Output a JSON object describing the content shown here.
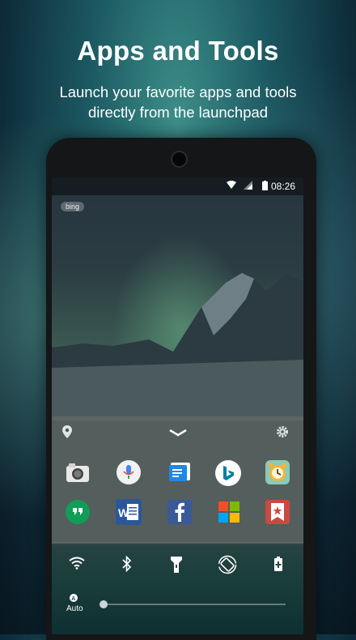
{
  "promo": {
    "title": "Apps and Tools",
    "subtitle_line1": "Launch your favorite apps and tools",
    "subtitle_line2": "directly from the launchpad"
  },
  "statusbar": {
    "time": "08:26",
    "icons": [
      "wifi-icon",
      "signal-icon",
      "battery-icon"
    ]
  },
  "wallpaper": {
    "badge": "bing"
  },
  "launchpad": {
    "top_icons": [
      "location-pin-icon",
      "chevron-down-icon",
      "gear-icon"
    ],
    "apps_row1": [
      "camera-app-icon",
      "voice-search-app-icon",
      "messages-app-icon",
      "bing-app-icon",
      "alarm-clock-app-icon"
    ],
    "apps_row2": [
      "hangouts-app-icon",
      "word-app-icon",
      "facebook-app-icon",
      "microsoft-store-app-icon",
      "wunderlist-app-icon"
    ],
    "toggles": [
      "wifi-toggle-icon",
      "bluetooth-toggle-icon",
      "flashlight-toggle-icon",
      "rotation-toggle-icon",
      "battery-saver-toggle-icon"
    ],
    "brightness": {
      "auto_label": "Auto",
      "level": 0.02
    }
  },
  "colors": {
    "accent_bing": "#00809d",
    "facebook": "#3b5998",
    "word": "#2b579a",
    "hangouts": "#0f9d58",
    "wunderlist": "#c94a3f"
  }
}
